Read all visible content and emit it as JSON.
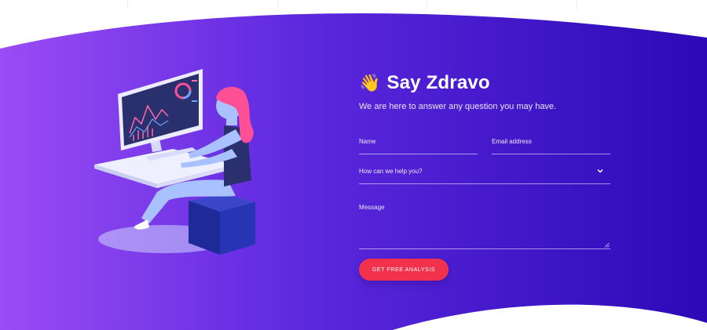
{
  "contact": {
    "wave_emoji": "👋",
    "title": "Say Zdravo",
    "subtitle": "We are here to answer any question you may have.",
    "fields": {
      "name_label": "Name",
      "email_label": "Email address",
      "help_label": "How can we help you?",
      "message_label": "Message"
    },
    "submit_label": "GET FREE ANALYSIS"
  },
  "colors": {
    "gradient_start": "#9a4cf5",
    "gradient_end": "#2c09b6",
    "button": "#f2324d",
    "accent_pink": "#ff4f95"
  },
  "icons": [
    "chevron-down-icon",
    "waving-hand-icon",
    "resize-handle-icon"
  ]
}
